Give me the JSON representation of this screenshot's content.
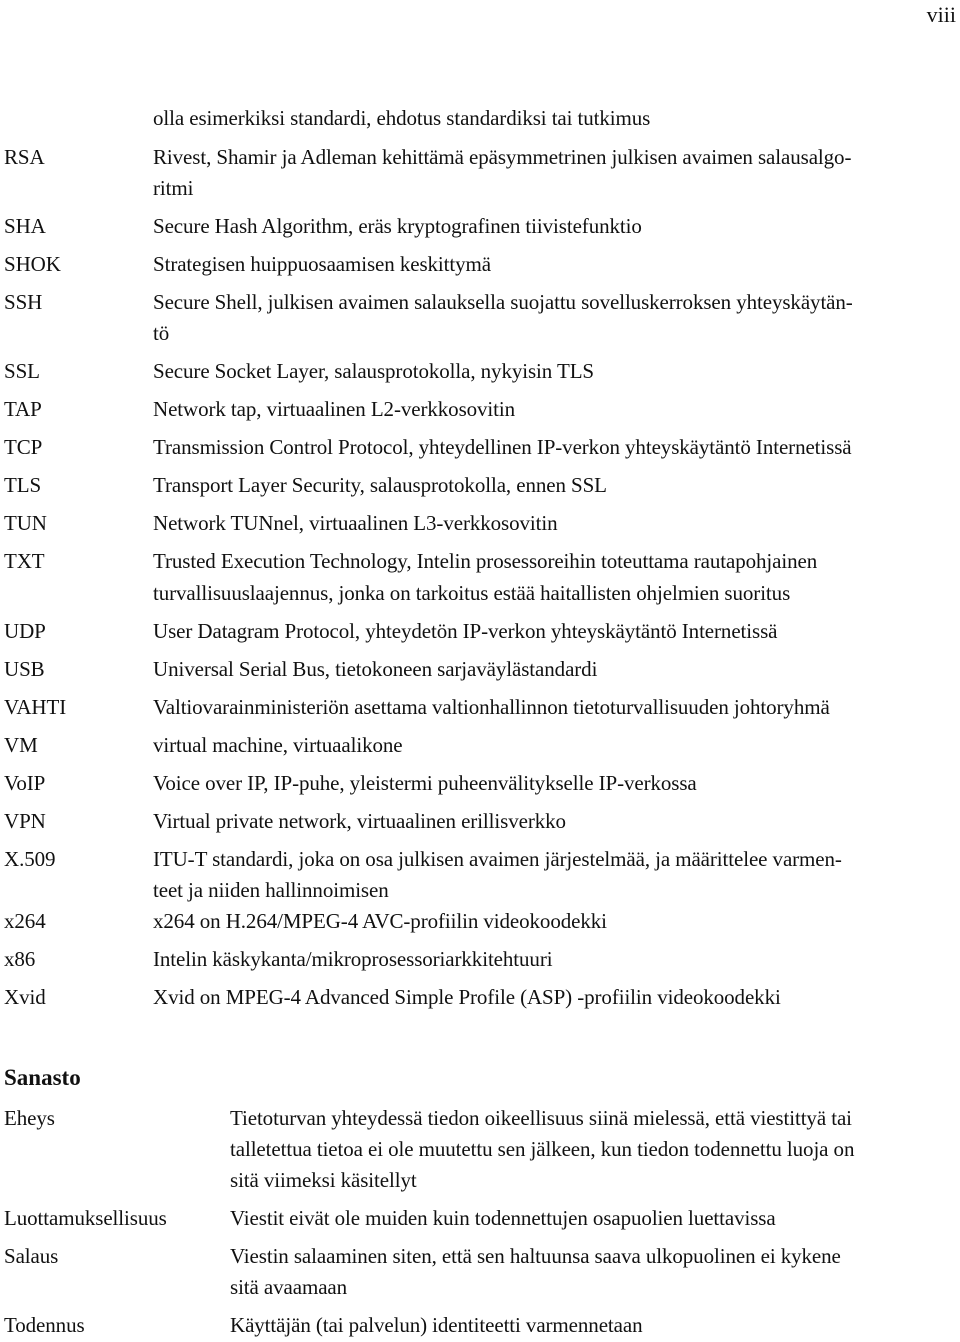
{
  "page_number": "viii",
  "continuation_line": "olla esimerkiksi standardi, ehdotus standardiksi tai tutkimus",
  "abbreviations": [
    {
      "term": "RSA",
      "lines": [
        "Rivest, Shamir ja Adleman kehittämä epäsymmetrinen julkisen avaimen salausalgo-",
        "ritmi"
      ]
    },
    {
      "term": "SHA",
      "lines": [
        "Secure Hash Algorithm, eräs kryptografinen tiivistefunktio"
      ]
    },
    {
      "term": "SHOK",
      "lines": [
        "Strategisen huippuosaamisen keskittymä"
      ]
    },
    {
      "term": "SSH",
      "lines": [
        "Secure Shell, julkisen avaimen salauksella suojattu sovelluskerroksen yhteyskäytän-",
        "tö"
      ]
    },
    {
      "term": "SSL",
      "lines": [
        "Secure Socket Layer, salausprotokolla, nykyisin TLS"
      ]
    },
    {
      "term": "TAP",
      "lines": [
        "Network tap, virtuaalinen L2-verkkosovitin"
      ]
    },
    {
      "term": "TCP",
      "lines": [
        "Transmission Control Protocol, yhteydellinen IP-verkon yhteyskäytäntö Internetissä"
      ]
    },
    {
      "term": "TLS",
      "lines": [
        "Transport Layer Security, salausprotokolla, ennen SSL"
      ]
    },
    {
      "term": "TUN",
      "lines": [
        "Network TUNnel, virtuaalinen L3-verkkosovitin"
      ]
    },
    {
      "term": "TXT",
      "lines": [
        "Trusted Execution Technology, Intelin prosessoreihin toteuttama rautapohjainen",
        "turvallisuuslaajennus, jonka on tarkoitus estää haitallisten ohjelmien suoritus"
      ]
    },
    {
      "term": "UDP",
      "lines": [
        "User Datagram Protocol, yhteydetön IP-verkon yhteyskäytäntö Internetissä"
      ]
    },
    {
      "term": "USB",
      "lines": [
        "Universal Serial Bus, tietokoneen sarjaväylästandardi"
      ]
    },
    {
      "term": "VAHTI",
      "lines": [
        "Valtiovarainministeriön asettama valtionhallinnon tietoturvallisuuden johtoryhmä"
      ]
    },
    {
      "term": "VM",
      "lines": [
        "virtual machine, virtuaalikone"
      ]
    },
    {
      "term": "VoIP",
      "lines": [
        "Voice over IP, IP-puhe, yleistermi puheenvälitykselle IP-verkossa"
      ]
    },
    {
      "term": "VPN",
      "lines": [
        "Virtual private network, virtuaalinen erillisverkko"
      ]
    },
    {
      "term": "X.509",
      "lines": [
        "ITU-T standardi, joka on osa julkisen avaimen järjestelmää, ja määrittelee varmen-",
        "teet ja niiden hallinnoimisen"
      ]
    },
    {
      "term": "x264",
      "lines": [
        "x264 on H.264/MPEG-4 AVC-profiilin videokoodekki"
      ]
    },
    {
      "term": "x86",
      "lines": [
        "Intelin käskykanta/mikroprosessoriarkkitehtuuri"
      ]
    },
    {
      "term": "Xvid",
      "lines": [
        "Xvid on MPEG-4 Advanced Simple Profile (ASP) -profiilin videokoodekki"
      ]
    }
  ],
  "glossary": {
    "heading": "Sanasto",
    "entries": [
      {
        "term": "Eheys",
        "lines": [
          "Tietoturvan yhteydessä tiedon oikeellisuus siinä mielessä, että viestittyä tai",
          "talletettua tietoa ei ole muutettu sen jälkeen, kun tiedon todennettu luoja on",
          "sitä viimeksi käsitellyt"
        ]
      },
      {
        "term": "Luottamuksellisuus",
        "lines": [
          "Viestit eivät ole muiden kuin todennettujen osapuolien luettavissa"
        ]
      },
      {
        "term": "Salaus",
        "lines": [
          "Viestin salaaminen siten, että sen haltuunsa saava ulkopuolinen ei kykene",
          "sitä avaamaan"
        ]
      },
      {
        "term": "Todennus",
        "lines": [
          "Käyttäjän (tai palvelun) identiteetti varmennetaan"
        ]
      }
    ]
  }
}
